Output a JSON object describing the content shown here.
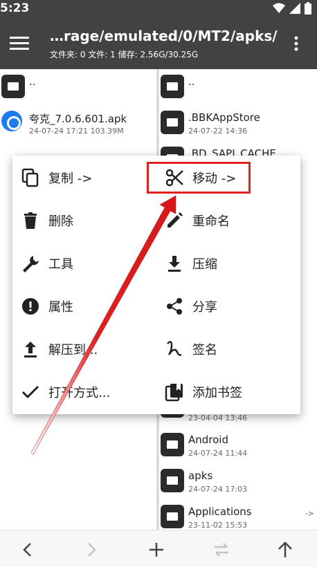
{
  "status": {
    "time": "5:23"
  },
  "header": {
    "path": "…rage/emulated/0/MT2/apks/",
    "info": "文件夹: 0  文件: 1  储存: 2.56G/30.25G"
  },
  "left_pane": {
    "items": [
      {
        "name": "..",
        "sub": ""
      },
      {
        "name": "夸克_7.0.6.601.apk",
        "sub": "24-07-24 17:21  103.39M"
      }
    ]
  },
  "right_pane": {
    "items": [
      {
        "name": "..",
        "sub": ""
      },
      {
        "name": ".BBKAppStore",
        "sub": "24-07-22 14:36"
      },
      {
        "name": ".BD_SAPI_CACHE",
        "sub": ""
      },
      {
        "name": "",
        "sub": "23-04-04 13:46"
      },
      {
        "name": "Android",
        "sub": "24-07-24 11:44"
      },
      {
        "name": "apks",
        "sub": "24-07-24 17:03"
      },
      {
        "name": "Applications",
        "sub": "23-11-02 15:53",
        "arrow": "->"
      }
    ]
  },
  "menu": {
    "items": [
      {
        "label": "复制 ->",
        "icon": "copy-icon"
      },
      {
        "label": "移动 ->",
        "icon": "cut-icon"
      },
      {
        "label": "删除",
        "icon": "delete-icon"
      },
      {
        "label": "重命名",
        "icon": "edit-icon"
      },
      {
        "label": "工具",
        "icon": "wrench-icon"
      },
      {
        "label": "压缩",
        "icon": "download-icon"
      },
      {
        "label": "属性",
        "icon": "info-icon"
      },
      {
        "label": "分享",
        "icon": "share-icon"
      },
      {
        "label": "解压到...",
        "icon": "upload-icon"
      },
      {
        "label": "签名",
        "icon": "signature-icon"
      },
      {
        "label": "打开方式...",
        "icon": "check-icon"
      },
      {
        "label": "添加书签",
        "icon": "bookmark-icon"
      }
    ]
  },
  "colors": {
    "appbar": "#424242",
    "highlight": "#e02020",
    "accent_blue": "#1c7cf0"
  }
}
